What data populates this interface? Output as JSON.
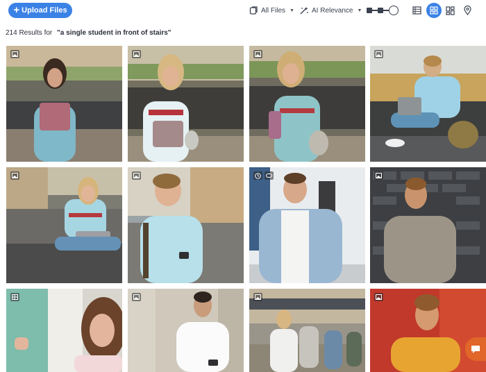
{
  "toolbar": {
    "upload_label": "Upload Files",
    "all_files_label": "All Files",
    "ai_relevance_label": "AI Relevance",
    "icons": [
      "clean-icon",
      "sparkle-icon",
      "size-slider",
      "list-view-icon",
      "grid-view-icon",
      "tile-view-icon",
      "location-pin-icon"
    ]
  },
  "search": {
    "count_text": "214 Results for",
    "query": "\"a single student in front of stairs\""
  },
  "results": [
    {
      "badge": "image-icon"
    },
    {
      "badge": "image-icon"
    },
    {
      "badge": "image-icon"
    },
    {
      "badge": "image-icon"
    },
    {
      "badge": "image-icon"
    },
    {
      "badge": "image-icon"
    },
    {
      "badge": "clock-icon, link-icon"
    },
    {
      "badge": "image-icon"
    },
    {
      "badge": "image-icon"
    },
    {
      "badge": "image-icon"
    },
    {
      "badge": "image-icon"
    },
    {
      "badge": "image-icon"
    }
  ],
  "colors": {
    "accent": "#3b82e6",
    "chat": "#e0662a"
  }
}
